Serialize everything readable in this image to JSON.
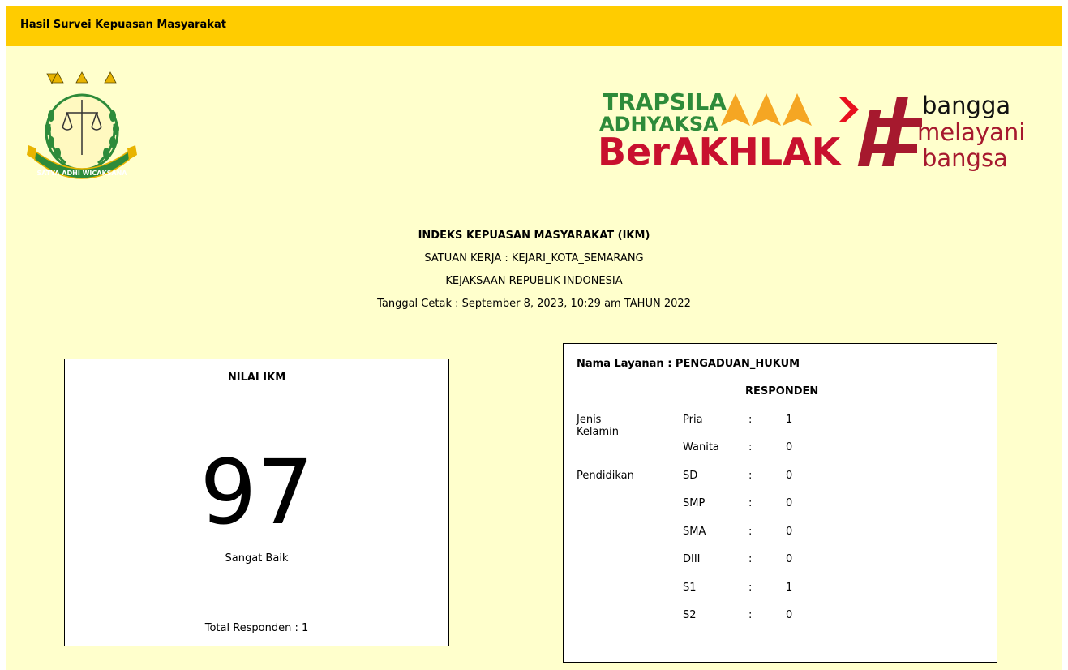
{
  "header": {
    "title": "Hasil Survei Kepuasan Masyarakat"
  },
  "logos": {
    "emblem": {
      "name": "kejaksaan-emblem",
      "motto": "SATYA ADHI WICAKSANA"
    },
    "brand": {
      "line1": "TRAPSILA",
      "line2": "ADHYAKSA",
      "line3": "BerAKHLAK",
      "tagline1": "bangga",
      "tagline2": "melayani",
      "tagline3": "bangsa",
      "colors": {
        "green": "#2e8b3a",
        "red": "#c8102e",
        "orange": "#f5a623",
        "maroon": "#a6192e"
      }
    }
  },
  "report": {
    "title": "INDEKS KEPUASAN MASYARAKAT (IKM)",
    "unit": "SATUAN KERJA : KEJARI_KOTA_SEMARANG",
    "institution": "KEJAKSAAN REPUBLIK INDONESIA",
    "print_date": "Tanggal Cetak : September 8, 2023, 10:29 am TAHUN 2022"
  },
  "ikm": {
    "label": "NILAI IKM",
    "value": "97",
    "category": "Sangat Baik",
    "total": "Total Responden : 1"
  },
  "service": {
    "name": "Nama Layanan : PENGADUAN_HUKUM",
    "respondents_title": "RESPONDEN",
    "rows": [
      {
        "group": "Jenis Kelamin",
        "label": "Pria",
        "sep": ":",
        "value": "1"
      },
      {
        "group": "",
        "label": "Wanita",
        "sep": ":",
        "value": "0"
      },
      {
        "group": "Pendidikan",
        "label": "SD",
        "sep": ":",
        "value": "0"
      },
      {
        "group": "",
        "label": "SMP",
        "sep": ":",
        "value": "0"
      },
      {
        "group": "",
        "label": "SMA",
        "sep": ":",
        "value": "0"
      },
      {
        "group": "",
        "label": "DIII",
        "sep": ":",
        "value": "0"
      },
      {
        "group": "",
        "label": "S1",
        "sep": ":",
        "value": "1"
      },
      {
        "group": "",
        "label": "S2",
        "sep": ":",
        "value": "0"
      }
    ]
  },
  "colors": {
    "topbar": "#ffcc00",
    "panel": "#ffffcc"
  }
}
